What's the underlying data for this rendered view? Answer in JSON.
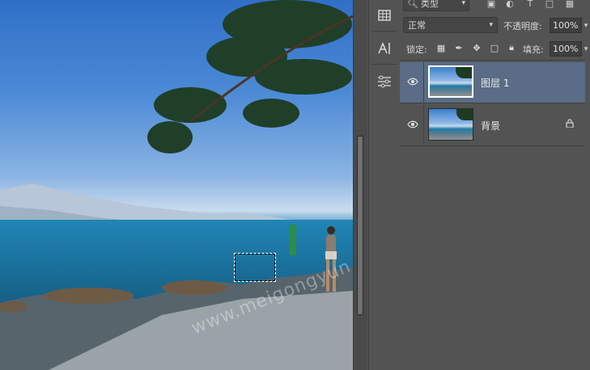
{
  "toolstrip": {
    "icons": [
      "grid-icon",
      "character-icon",
      "adjustments-icon"
    ]
  },
  "layers_panel": {
    "filter_kind": "类型",
    "filter_icons": [
      "image-filter-icon",
      "adjustment-filter-icon",
      "type-filter-icon",
      "shape-filter-icon",
      "smart-object-filter-icon"
    ],
    "blend_mode": "正常",
    "opacity_label": "不透明度:",
    "opacity_value": "100%",
    "lock_label": "锁定:",
    "lock_icons": [
      "lock-transparent-icon",
      "lock-brush-icon",
      "lock-move-icon",
      "lock-artboard-icon",
      "lock-all-icon"
    ],
    "fill_label": "填充:",
    "fill_value": "100%",
    "layers": [
      {
        "name": "图层 1",
        "visible": true,
        "selected": true,
        "locked": false
      },
      {
        "name": "背景",
        "visible": true,
        "selected": false,
        "locked": true
      }
    ]
  },
  "canvas": {
    "watermark": "www.meigongyun.com"
  },
  "colors": {
    "panel_bg": "#535353",
    "selected_layer": "#5a6c86"
  }
}
